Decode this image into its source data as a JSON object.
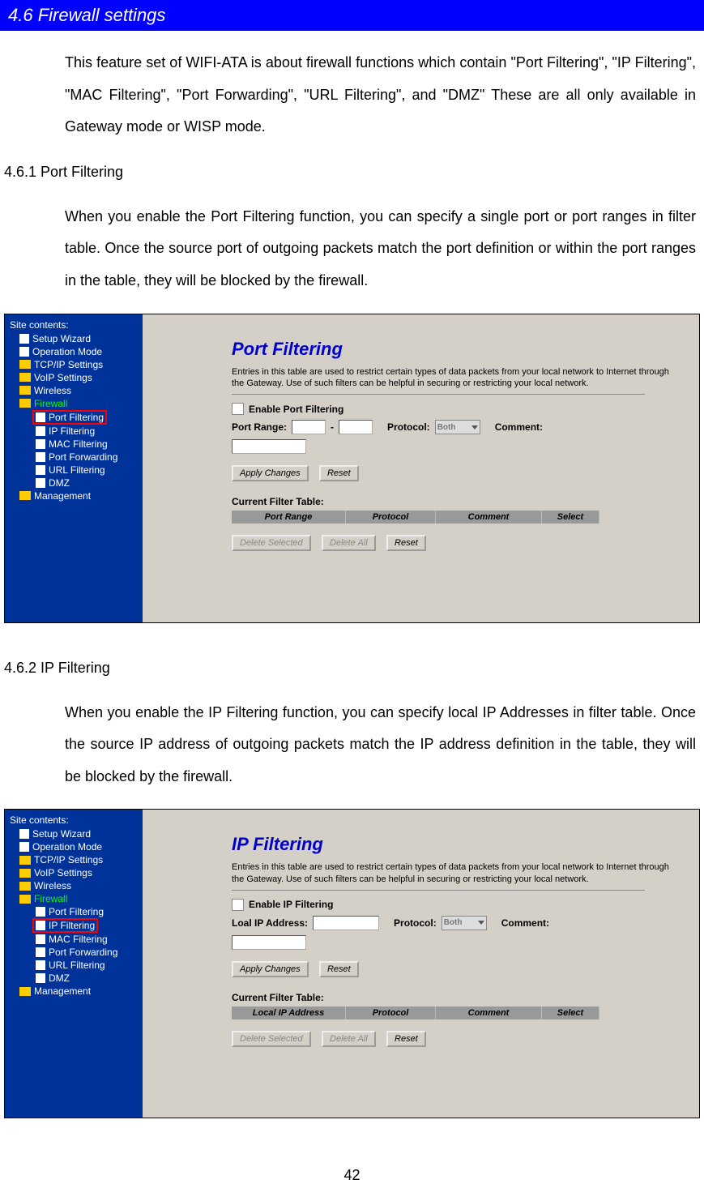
{
  "header": "4.6    Firewall settings",
  "intro": "This feature set of WIFI-ATA is about firewall functions which contain \"Port Filtering\", \"IP Filtering\", \"MAC Filtering\", \"Port Forwarding\", \"URL Filtering\", and \"DMZ\" These are all only available in Gateway mode or WISP mode.",
  "sections": {
    "port": {
      "heading": "4.6.1 Port Filtering",
      "text": "When you enable the Port Filtering function, you can specify a single port or port ranges in filter table. Once the source port of outgoing packets match the port definition or within the port ranges in the table, they will be blocked by the firewall."
    },
    "ip": {
      "heading": "4.6.2 IP Filtering",
      "text": "When you enable the IP Filtering function, you can specify local IP Addresses in filter table. Once the source IP address of outgoing packets match the IP address definition in the table, they will be blocked by the firewall."
    }
  },
  "sidebar": {
    "title": "Site contents:",
    "items": {
      "wizard": "Setup Wizard",
      "opmode": "Operation Mode",
      "tcpip": "TCP/IP Settings",
      "voip": "VoIP Settings",
      "wireless": "Wireless",
      "firewall": "Firewall",
      "port_filtering": "Port Filtering",
      "ip_filtering": "IP Filtering",
      "mac_filtering": "MAC Filtering",
      "port_forwarding": "Port Forwarding",
      "url_filtering": "URL Filtering",
      "dmz": "DMZ",
      "management": "Management"
    }
  },
  "pane_port": {
    "title": "Port Filtering",
    "desc": "Entries in this table are used to restrict certain types of data packets from your local network to Internet through the Gateway. Use of such filters can be helpful in securing or restricting your local network.",
    "enable_label": "Enable Port Filtering",
    "port_range_label": "Port Range:",
    "protocol_label": "Protocol:",
    "protocol_value": "Both",
    "comment_label": "Comment:",
    "apply": "Apply Changes",
    "reset": "Reset",
    "table_label": "Current Filter Table:",
    "th1": "Port Range",
    "th2": "Protocol",
    "th3": "Comment",
    "th4": "Select",
    "del_sel": "Delete Selected",
    "del_all": "Delete All",
    "reset2": "Reset"
  },
  "pane_ip": {
    "title": "IP Filtering",
    "desc": "Entries in this table are used to restrict certain types of data packets from your local network to Internet through the Gateway. Use of such filters can be helpful in securing or restricting your local network.",
    "enable_label": "Enable IP Filtering",
    "ip_label": "Loal IP Address:",
    "protocol_label": "Protocol:",
    "protocol_value": "Both",
    "comment_label": "Comment:",
    "apply": "Apply Changes",
    "reset": "Reset",
    "table_label": "Current Filter Table:",
    "th1": "Local IP Address",
    "th2": "Protocol",
    "th3": "Comment",
    "th4": "Select",
    "del_sel": "Delete Selected",
    "del_all": "Delete All",
    "reset2": "Reset"
  },
  "page_number": "42"
}
